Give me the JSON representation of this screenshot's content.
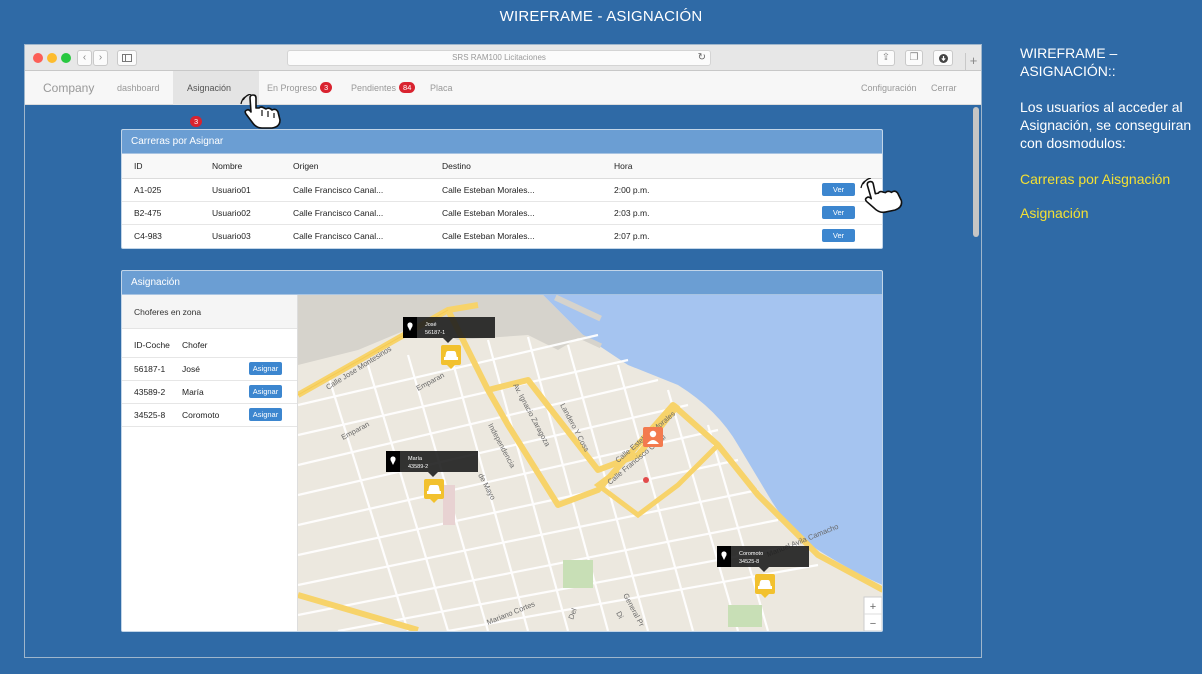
{
  "slide": {
    "title": "WIREFRAME - ASIGNACIÓN"
  },
  "notes": {
    "title": "WIREFRAME – ASIGNACIÓN::",
    "description": "Los usuarios al acceder al Asignación, se conseguiran con dosmodulos:",
    "highlights": [
      "Carreras por Aisgnación",
      "Asignación"
    ]
  },
  "browser": {
    "url": "SRS RAM100 Licitaciones"
  },
  "navbar": {
    "brand": "Company",
    "items": [
      {
        "label": "dashboard",
        "badge": ""
      },
      {
        "label": "Asignación",
        "badge": "3"
      },
      {
        "label": "En Progreso",
        "badge": "3"
      },
      {
        "label": "Pendientes",
        "badge": "84"
      },
      {
        "label": "Placa",
        "badge": ""
      }
    ],
    "right": [
      "Configuración",
      "Cerrar"
    ]
  },
  "carreras": {
    "title": "Carreras por Asignar",
    "columns": [
      "ID",
      "Nombre",
      "Origen",
      "Destino",
      "Hora"
    ],
    "button_label": "Ver",
    "rows": [
      {
        "id": "A1-025",
        "nombre": "Usuario01",
        "origen": "Calle Francisco Canal...",
        "destino": "Calle Esteban Morales...",
        "hora": "2:00 p.m."
      },
      {
        "id": "B2-475",
        "nombre": "Usuario02",
        "origen": "Calle Francisco Canal...",
        "destino": "Calle Esteban Morales...",
        "hora": "2:03 p.m."
      },
      {
        "id": "C4-983",
        "nombre": "Usuario03",
        "origen": "Calle Francisco Canal...",
        "destino": "Calle Esteban Morales...",
        "hora": "2:07 p.m."
      }
    ]
  },
  "asignacion": {
    "title": "Asignación",
    "subtitle": "Choferes en zona",
    "columns": [
      "ID-Coche",
      "Chofer"
    ],
    "button_label": "Asignar",
    "rows": [
      {
        "id": "56187-1",
        "chofer": "José"
      },
      {
        "id": "43589-2",
        "chofer": "María"
      },
      {
        "id": "34525-8",
        "chofer": "Coromoto"
      }
    ]
  },
  "map": {
    "markers": [
      {
        "name": "José",
        "id": "56187-1"
      },
      {
        "name": "María",
        "id": "43589-2"
      },
      {
        "name": "Coromoto",
        "id": "34525-8"
      }
    ],
    "streets": [
      "Calle Jose Montesinos",
      "Emparan",
      "Emparan",
      "Av. Ignacio Zaragoza",
      "Landero Y Coss",
      "Calle Esteban Morales",
      "Calle Francisco Canal",
      "Independencia",
      "Manuel Avila Camacho",
      "de Mayo",
      "Mariano Cortes",
      "General Pr",
      "Di",
      "Del"
    ],
    "zoom_in": "+",
    "zoom_out": "−"
  }
}
